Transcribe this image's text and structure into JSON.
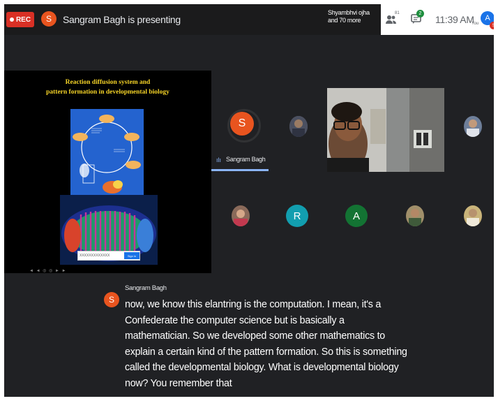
{
  "topbar": {
    "rec_label": "REC",
    "presenter_initial": "S",
    "presenting_text": "Sangram Bagh is presenting",
    "viewers_line1": "Shyambhvi ojha",
    "viewers_line2": "and 70 more",
    "people_count": "81",
    "chat_badge": "2",
    "time": "11:39 AM",
    "you_label": "You",
    "you_initial": "A",
    "you_badge": "S"
  },
  "slide": {
    "title_line1": "Reaction diffusion system and",
    "title_line2": "pattern formation in developmental biology",
    "caption_placeholder": "XXXXXXXXXXXXX",
    "caption_button": "Sign in",
    "nav": "◄ ◄ ◎ ◎ ► ►"
  },
  "participants": {
    "presenter_initial": "S",
    "presenter_name": "Sangram Bagh",
    "initial_r": "R",
    "initial_a": "A"
  },
  "captions": {
    "speaker_initial": "S",
    "speaker_name": "Sangram Bagh",
    "text": "now, we know this elantring is the computation. I mean, it's a Confederate the computer science but is basically a mathematician. So we developed some other mathematics to explain a certain kind of the pattern formation. So this is something called the developmental biology. What is developmental biology now? You remember that"
  },
  "colors": {
    "rec": "#d93025",
    "presenter_avatar": "#e8541f",
    "avatar_r": "#129eaf",
    "avatar_a": "#137333",
    "you_avatar": "#1a73e8",
    "active_speaker": "#8ab4f8"
  }
}
